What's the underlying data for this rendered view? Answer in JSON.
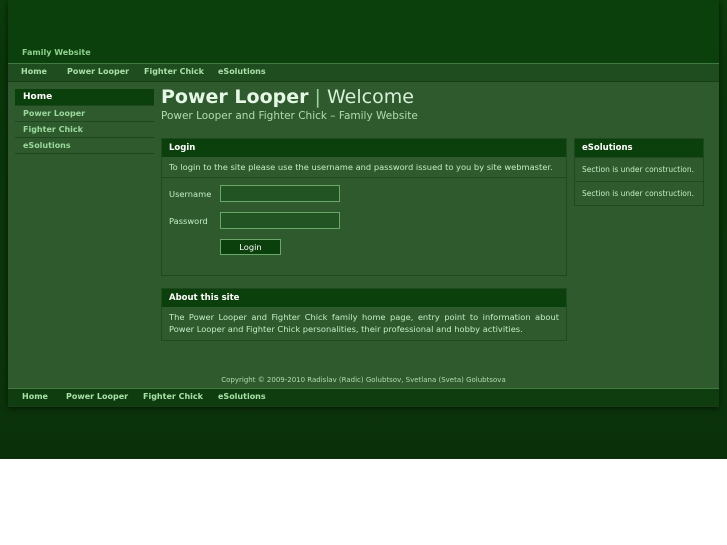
{
  "header": {
    "site_name": "Family Website"
  },
  "nav": {
    "items": [
      "Home",
      "Power Looper",
      "Fighter Chick",
      "eSolutions"
    ]
  },
  "sidebar": {
    "items": [
      "Home",
      "Power Looper",
      "Fighter Chick",
      "eSolutions"
    ],
    "active": "Home"
  },
  "main": {
    "title_strong": "Power Looper",
    "title_sep": "|",
    "title_rest": "Welcome",
    "subtitle": "Power Looper and Fighter Chick – Family Website"
  },
  "login": {
    "heading": "Login",
    "instructions": "To login to the site please use the username and password issued to you by site webmaster.",
    "username_label": "Username",
    "password_label": "Password",
    "username_value": "",
    "password_value": "",
    "button_label": "Login"
  },
  "about": {
    "heading": "About this site",
    "text": "The Power Looper and Fighter Chick family home page, entry point to information about Power Looper and Fighter Chick personalities, their professional and hobby activities."
  },
  "esolutions": {
    "heading": "eSolutions",
    "items": [
      "Section is under construction.",
      "Section is under construction."
    ]
  },
  "footer": {
    "copyright": "Copyright © 2009-2010 Radislav (Radic) Golubtsov, Svetlana (Sveta) Golubtsova"
  },
  "colors": {
    "background": "#0b340b",
    "page": "#2e5a2e",
    "header_bar": "#0b3f0b",
    "link": "#a8e0a8",
    "text": "#c6ecc6",
    "empty_area": "#ffffff"
  }
}
